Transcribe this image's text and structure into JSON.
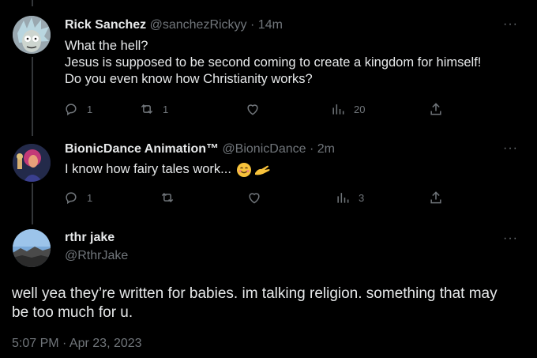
{
  "tweets": [
    {
      "name": "Rick Sanchez",
      "handle": "@sanchezRickyy",
      "time": "14m",
      "text1": "What the hell?",
      "text2": "Jesus is supposed to be second coming to create a kingdom for himself!",
      "text3": "Do you even know how Christianity works?",
      "replies": "1",
      "retweets": "1",
      "views": "20"
    },
    {
      "name": "BionicDance Animation™",
      "handle": "@BionicDance",
      "time": "2m",
      "text1": "I know how fairy tales work...",
      "replies": "1",
      "views": "3"
    }
  ],
  "main_tweet": {
    "name": "rthr jake",
    "handle": "@RthrJake",
    "text": "well yea they’re written for babies. im talking religion. something that may be too much for u.",
    "timestamp": "5:07 PM · Apr 23, 2023"
  },
  "ui": {
    "separator": "·",
    "more": "···"
  }
}
